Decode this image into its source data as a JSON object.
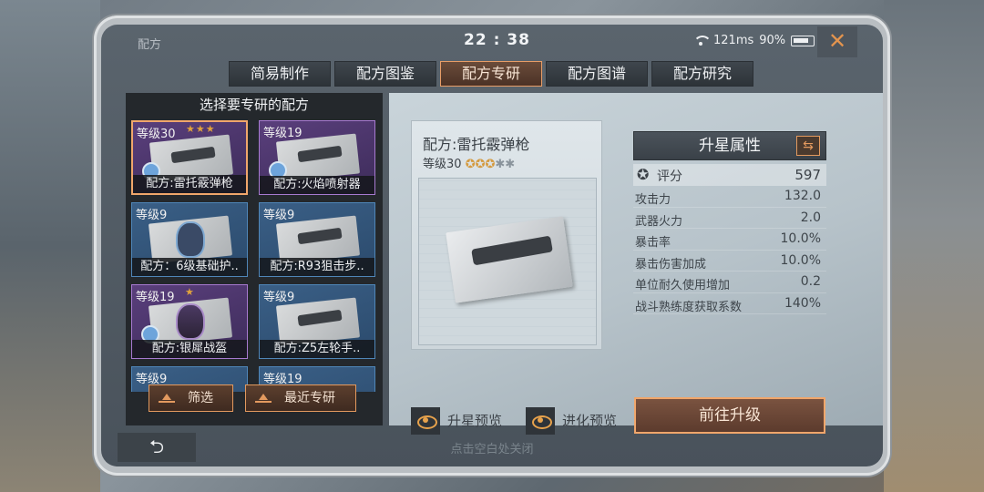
{
  "topbar": {
    "title": "配方",
    "clock": "22 : 38",
    "ping": "121ms",
    "battery": "90%",
    "close": "✕"
  },
  "tabs": [
    {
      "label": "简易制作",
      "active": false
    },
    {
      "label": "配方图鉴",
      "active": false
    },
    {
      "label": "配方专研",
      "active": true
    },
    {
      "label": "配方图谱",
      "active": false
    },
    {
      "label": "配方研究",
      "active": false
    }
  ],
  "left": {
    "header": "选择要专研的配方",
    "cards": [
      {
        "level": "等级30",
        "stars": "★★★",
        "name": "配方:雷托霰弹枪",
        "rarity": "purple",
        "selected": true
      },
      {
        "level": "等级19",
        "stars": "",
        "name": "配方:火焰喷射器",
        "rarity": "purple",
        "selected": false
      },
      {
        "level": "等级9",
        "stars": "",
        "name": "配方：6级基础护..",
        "rarity": "blue",
        "selected": false
      },
      {
        "level": "等级9",
        "stars": "",
        "name": "配方:R93狙击步..",
        "rarity": "blue",
        "selected": false
      },
      {
        "level": "等级19",
        "stars": "★",
        "name": "配方:银犀战盔",
        "rarity": "purple",
        "selected": false
      },
      {
        "level": "等级9",
        "stars": "",
        "name": "配方:Z5左轮手..",
        "rarity": "blue",
        "selected": false
      },
      {
        "level": "等级9",
        "stars": "",
        "name": "",
        "rarity": "blue",
        "selected": false
      },
      {
        "level": "等级19",
        "stars": "",
        "name": "",
        "rarity": "blue",
        "selected": false
      }
    ],
    "filter_label": "筛选",
    "recent_label": "最近专研"
  },
  "detail": {
    "title": "配方:雷托霰弹枪",
    "level": "等级30",
    "stars_filled": "✪✪✪",
    "stars_empty": "✱✱",
    "star_attr_header": "升星属性",
    "score_label": "评分",
    "score_value": "597",
    "attrs": [
      {
        "label": "攻击力",
        "value": "132.0"
      },
      {
        "label": "武器火力",
        "value": "2.0"
      },
      {
        "label": "暴击率",
        "value": "10.0%"
      },
      {
        "label": "暴击伤害加成",
        "value": "10.0%"
      },
      {
        "label": "单位耐久使用增加",
        "value": "0.2"
      },
      {
        "label": "战斗熟练度获取系数",
        "value": "140%"
      }
    ],
    "preview_star": "升星预览",
    "preview_evolve": "进化预览",
    "go_upgrade": "前往升级"
  },
  "bottom": {
    "back": "⮌",
    "hint": "点击空白处关闭"
  },
  "colors": {
    "accent": "#f0a66b",
    "star": "#e0a23c",
    "purple_rarity": "#a77ad0",
    "blue_rarity": "#4f86b8"
  }
}
